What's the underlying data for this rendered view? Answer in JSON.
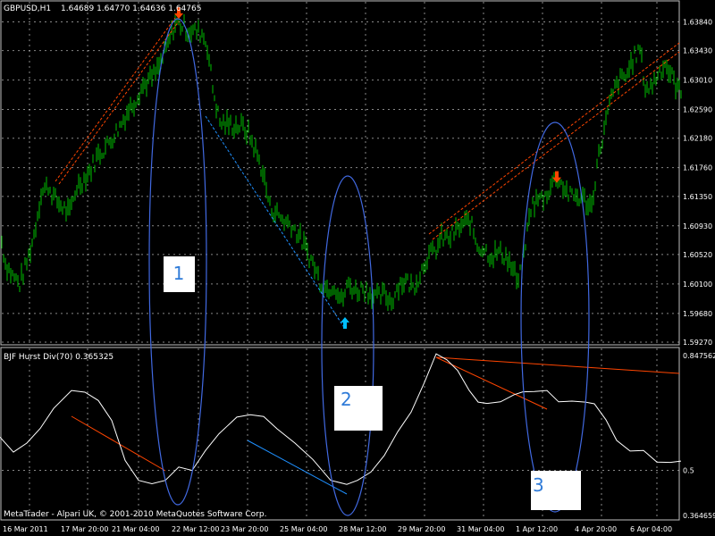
{
  "header": {
    "symbol": "GBPUSD,H1",
    "ohlc": "1.64689 1.64770 1.64636 1.64765"
  },
  "indicator": {
    "label": "BJF Hurst Div(70) 0.365325"
  },
  "footer": {
    "copyright": "MetaTrader - Alpari UK, © 2001-2010 MetaQuotes Software Corp."
  },
  "annotations": [
    {
      "label": "1"
    },
    {
      "label": "2"
    },
    {
      "label": "3"
    }
  ],
  "colors": {
    "background": "#000000",
    "grid": "#c0c0c0",
    "price_bars": "#00c000",
    "indicator_line": "#ffffff",
    "bearish_divergence": "#ff4500",
    "bullish_divergence": "#1e90ff",
    "ellipses": "#4169e1",
    "axis_text": "#ffffff"
  },
  "chart_data": [
    {
      "type": "bar",
      "title": "GBPUSD,H1",
      "y_axis_ticks": [
        "1.63840",
        "1.63430",
        "1.63010",
        "1.62590",
        "1.62180",
        "1.61760",
        "1.61350",
        "1.60930",
        "1.60520",
        "1.60100",
        "1.59680",
        "1.59270"
      ],
      "ylim": [
        1.5927,
        1.6405
      ],
      "x_axis_ticks": [
        "16 Mar 2011",
        "17 Mar 20:00",
        "21 Mar 04:00",
        "22 Mar 12:00",
        "23 Mar 20:00",
        "25 Mar 04:00",
        "28 Mar 12:00",
        "29 Mar 20:00",
        "31 Mar 04:00",
        "1 Apr 12:00",
        "4 Apr 20:00",
        "6 Apr 04:00"
      ],
      "price_path": [
        [
          0,
          1.6085
        ],
        [
          6,
          1.604
        ],
        [
          14,
          1.6022
        ],
        [
          22,
          1.601
        ],
        [
          30,
          1.604
        ],
        [
          38,
          1.608
        ],
        [
          46,
          1.614
        ],
        [
          54,
          1.615
        ],
        [
          62,
          1.613
        ],
        [
          70,
          1.612
        ],
        [
          78,
          1.611
        ],
        [
          86,
          1.615
        ],
        [
          94,
          1.616
        ],
        [
          102,
          1.6175
        ],
        [
          110,
          1.6195
        ],
        [
          118,
          1.6205
        ],
        [
          126,
          1.622
        ],
        [
          134,
          1.6235
        ],
        [
          142,
          1.6255
        ],
        [
          150,
          1.627
        ],
        [
          158,
          1.629
        ],
        [
          166,
          1.63
        ],
        [
          174,
          1.631
        ],
        [
          182,
          1.633
        ],
        [
          190,
          1.636
        ],
        [
          196,
          1.6382
        ],
        [
          202,
          1.638
        ],
        [
          210,
          1.6372
        ],
        [
          218,
          1.637
        ],
        [
          226,
          1.6368
        ],
        [
          232,
          1.635
        ],
        [
          238,
          1.629
        ],
        [
          246,
          1.624
        ],
        [
          254,
          1.6238
        ],
        [
          262,
          1.6236
        ],
        [
          270,
          1.6235
        ],
        [
          278,
          1.6225
        ],
        [
          286,
          1.62
        ],
        [
          294,
          1.617
        ],
        [
          302,
          1.612
        ],
        [
          310,
          1.611
        ],
        [
          318,
          1.61
        ],
        [
          326,
          1.6095
        ],
        [
          334,
          1.608
        ],
        [
          342,
          1.606
        ],
        [
          350,
          1.604
        ],
        [
          358,
          1.6015
        ],
        [
          366,
          1.6003
        ],
        [
          374,
          1.601
        ],
        [
          382,
          1.5985
        ],
        [
          390,
          1.601
        ],
        [
          398,
          1.6
        ],
        [
          406,
          1.6005
        ],
        [
          414,
          1.5998
        ],
        [
          422,
          1.599
        ],
        [
          430,
          1.5995
        ],
        [
          438,
          1.5985
        ],
        [
          446,
          1.601
        ],
        [
          454,
          1.6015
        ],
        [
          462,
          1.6005
        ],
        [
          470,
          1.6025
        ],
        [
          478,
          1.605
        ],
        [
          486,
          1.6055
        ],
        [
          494,
          1.6075
        ],
        [
          502,
          1.6075
        ],
        [
          510,
          1.6085
        ],
        [
          518,
          1.6095
        ],
        [
          526,
          1.61
        ],
        [
          534,
          1.6065
        ],
        [
          542,
          1.606
        ],
        [
          550,
          1.605
        ],
        [
          558,
          1.6055
        ],
        [
          566,
          1.605
        ],
        [
          574,
          1.603
        ],
        [
          580,
          1.601
        ],
        [
          586,
          1.605
        ],
        [
          594,
          1.612
        ],
        [
          602,
          1.613
        ],
        [
          610,
          1.6135
        ],
        [
          618,
          1.6155
        ],
        [
          624,
          1.616
        ],
        [
          630,
          1.615
        ],
        [
          638,
          1.6135
        ],
        [
          646,
          1.6135
        ],
        [
          654,
          1.613
        ],
        [
          662,
          1.612
        ],
        [
          668,
          1.618
        ],
        [
          676,
          1.623
        ],
        [
          684,
          1.6275
        ],
        [
          692,
          1.63
        ],
        [
          700,
          1.6305
        ],
        [
          708,
          1.633
        ],
        [
          716,
          1.6345
        ],
        [
          722,
          1.629
        ],
        [
          728,
          1.629
        ],
        [
          736,
          1.631
        ],
        [
          744,
          1.6325
        ],
        [
          750,
          1.631
        ],
        [
          756,
          1.6295
        ],
        [
          762,
          1.628
        ]
      ],
      "signals": [
        {
          "kind": "sell-arrow",
          "x_tick": "22 Mar 12:00",
          "price": 1.6396
        },
        {
          "kind": "buy-arrow",
          "x_tick": "28 Mar 12:00",
          "price": 1.5955
        },
        {
          "kind": "sell-arrow",
          "x_tick": "4 Apr 20:00",
          "price": 1.6162
        }
      ]
    },
    {
      "type": "line",
      "title": "BJF Hurst Div(70) 0.365325",
      "y_axis_ticks": [
        "0.847562",
        "0.5",
        "0.364659"
      ],
      "ylim": [
        0.364659,
        0.847562
      ],
      "levels": [
        0.5
      ],
      "values": [
        [
          0,
          0.6
        ],
        [
          15,
          0.555
        ],
        [
          30,
          0.582
        ],
        [
          45,
          0.626
        ],
        [
          60,
          0.686
        ],
        [
          80,
          0.74
        ],
        [
          95,
          0.735
        ],
        [
          110,
          0.71
        ],
        [
          125,
          0.65
        ],
        [
          140,
          0.53
        ],
        [
          155,
          0.47
        ],
        [
          170,
          0.46
        ],
        [
          185,
          0.47
        ],
        [
          200,
          0.51
        ],
        [
          215,
          0.5
        ],
        [
          230,
          0.56
        ],
        [
          245,
          0.61
        ],
        [
          265,
          0.66
        ],
        [
          280,
          0.667
        ],
        [
          295,
          0.662
        ],
        [
          310,
          0.625
        ],
        [
          330,
          0.582
        ],
        [
          350,
          0.533
        ],
        [
          370,
          0.47
        ],
        [
          388,
          0.458
        ],
        [
          400,
          0.47
        ],
        [
          415,
          0.495
        ],
        [
          430,
          0.545
        ],
        [
          445,
          0.616
        ],
        [
          460,
          0.675
        ],
        [
          475,
          0.765
        ],
        [
          488,
          0.85
        ],
        [
          500,
          0.832
        ],
        [
          512,
          0.8
        ],
        [
          525,
          0.74
        ],
        [
          535,
          0.705
        ],
        [
          545,
          0.701
        ],
        [
          560,
          0.706
        ],
        [
          575,
          0.727
        ],
        [
          585,
          0.736
        ],
        [
          598,
          0.737
        ],
        [
          612,
          0.74
        ],
        [
          625,
          0.706
        ],
        [
          640,
          0.708
        ],
        [
          655,
          0.705
        ],
        [
          665,
          0.7
        ],
        [
          678,
          0.652
        ],
        [
          690,
          0.59
        ],
        [
          705,
          0.558
        ],
        [
          720,
          0.56
        ],
        [
          735,
          0.525
        ],
        [
          750,
          0.524
        ],
        [
          762,
          0.528
        ]
      ]
    }
  ]
}
